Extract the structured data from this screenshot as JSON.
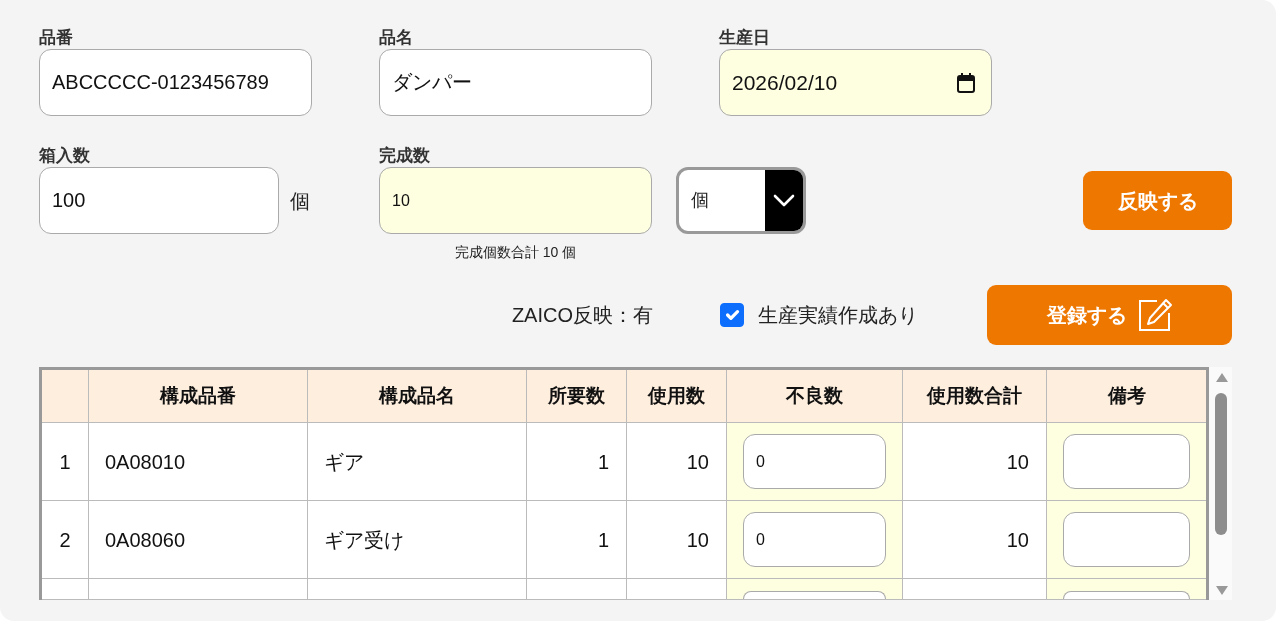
{
  "form": {
    "fields": [
      {
        "kind": "text",
        "label": "品番",
        "value": "ABCCCCC-0123456789",
        "highlighted": false
      },
      {
        "kind": "text",
        "label": "品名",
        "value": "ダンパー",
        "highlighted": false
      },
      {
        "kind": "date",
        "label": "生産日",
        "value": "2026/02/10",
        "highlighted": true
      }
    ]
  },
  "quantities": {
    "box_quantity": {
      "label": "箱入数",
      "value": "100",
      "unit": "個",
      "highlighted": false
    },
    "completed_quantity": {
      "label": "完成数",
      "value": "10",
      "highlighted": true,
      "total_note": "完成個数合計 10 個"
    },
    "unit_dropdown": {
      "value": "個"
    },
    "apply_button": "反映する"
  },
  "options": {
    "zaico_status": "ZAICO反映：有",
    "production_record": {
      "label": "生産実績作成あり",
      "checked": true
    },
    "register_button": "登録する"
  },
  "table": {
    "columns": [
      {
        "kind": "index"
      },
      {
        "kind": "text",
        "label": "構成品番"
      },
      {
        "kind": "text",
        "label": "構成品名"
      },
      {
        "kind": "number",
        "label": "所要数"
      },
      {
        "kind": "number",
        "label": "使用数"
      },
      {
        "kind": "input",
        "label": "不良数"
      },
      {
        "kind": "number",
        "label": "使用数合計"
      },
      {
        "kind": "input",
        "label": "備考"
      }
    ],
    "rows": [
      {
        "cells": [
          "1",
          "0A08010",
          "ギア",
          "1",
          "10",
          "0",
          "10"
        ]
      },
      {
        "cells": [
          "2",
          "0A08060",
          "ギア受け",
          "1",
          "10",
          "0",
          "10"
        ]
      }
    ],
    "more_rows_below": true
  }
}
